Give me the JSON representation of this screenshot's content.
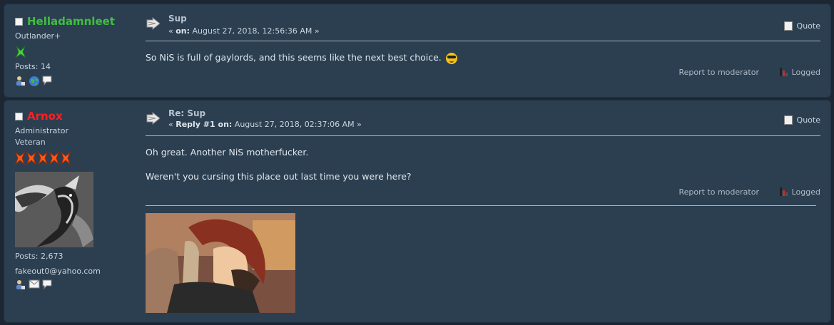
{
  "posts": [
    {
      "username": "Helladamnleet",
      "username_color": "#3fbf3f",
      "group": "Outlander+",
      "posts_label": "Posts: 14",
      "subject": "Sup",
      "meta_prefix": "« ",
      "meta_on": "on:",
      "meta_date": " August 27, 2018, 12:56:36 AM »",
      "body": [
        "So NiS is full of gaylords, and this seems like the next best choice."
      ],
      "smiley": "cool-smiley-icon",
      "quote_label": "Quote",
      "report_label": "Report to moderator",
      "logged_label": "Logged",
      "poster_icons": [
        "profile-icon",
        "website-icon",
        "pm-icon"
      ]
    },
    {
      "username": "Arnox",
      "username_color": "#ff2020",
      "group": "Administrator",
      "rank": "Veteran",
      "stars": 5,
      "posts_label": "Posts: 2,673",
      "email": "fakeout0@yahoo.com",
      "subject": "Re: Sup",
      "meta_prefix": "« ",
      "meta_on": "Reply #1 on:",
      "meta_date": " August 27, 2018, 02:37:06 AM »",
      "body": [
        "Oh great. Another NiS motherfucker.",
        "Weren't you cursing this place out last time you were here?"
      ],
      "quote_label": "Quote",
      "report_label": "Report to moderator",
      "logged_label": "Logged",
      "poster_icons": [
        "profile-icon",
        "email-icon",
        "pm-icon"
      ]
    }
  ],
  "colors": {
    "post_bg": "#2b3f51",
    "page_bg": "#1c2733",
    "star": "#ff5a1a"
  }
}
